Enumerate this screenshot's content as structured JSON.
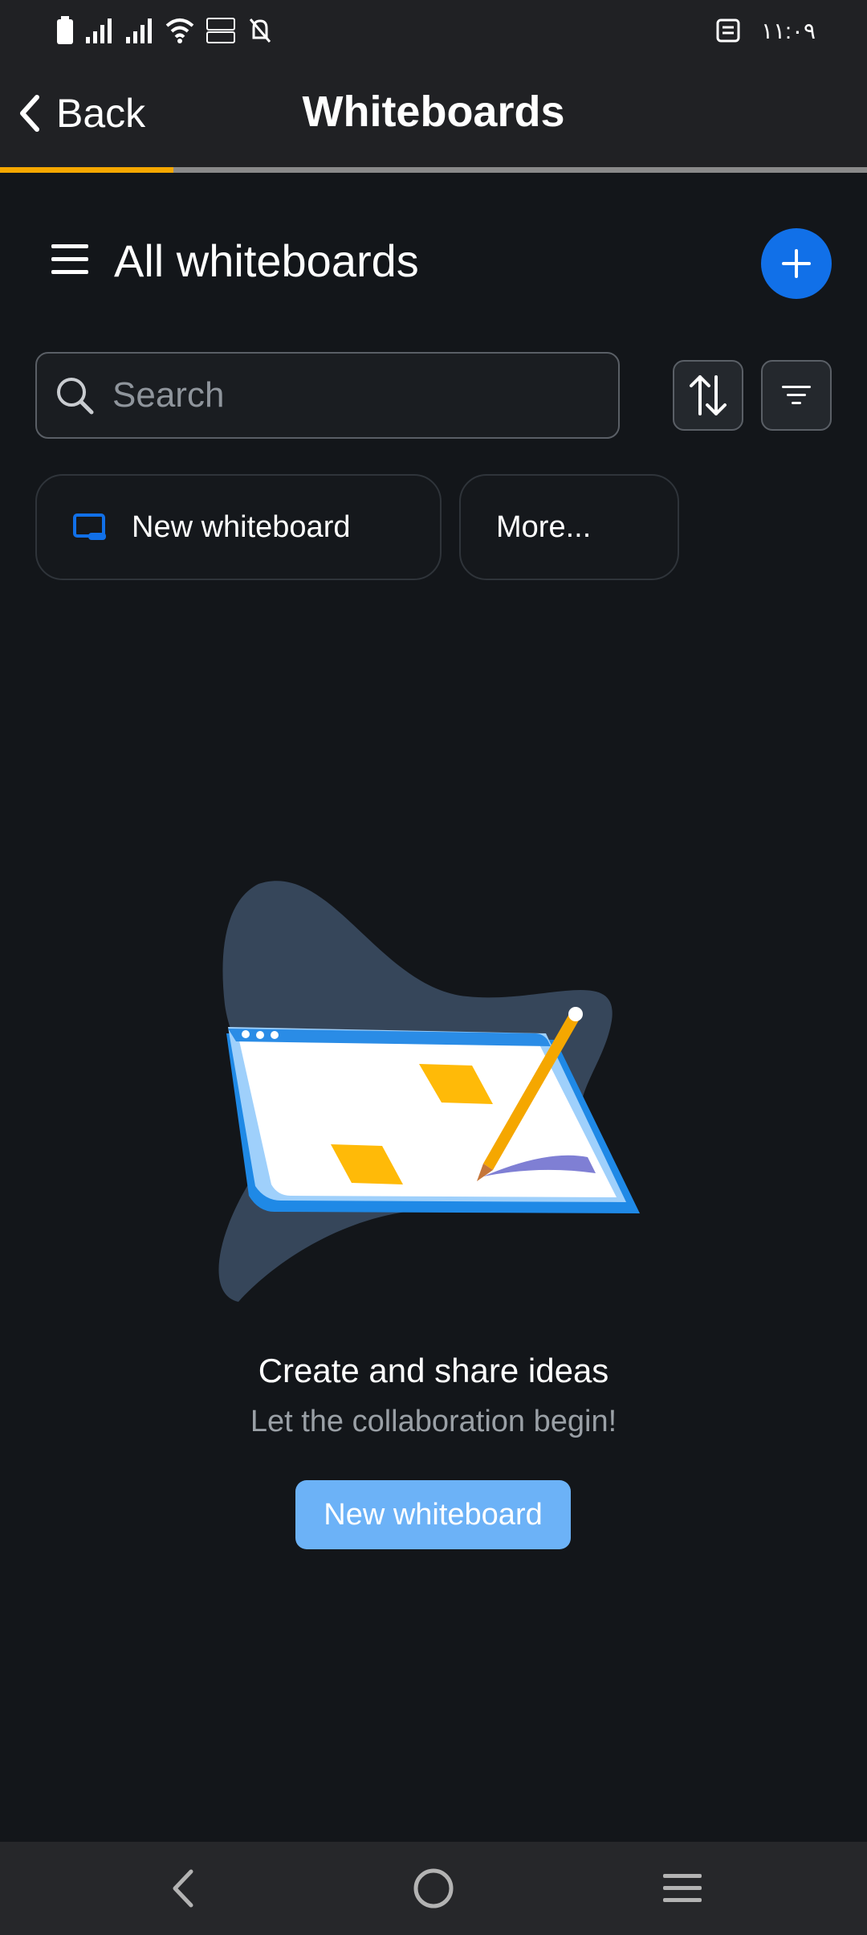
{
  "status_bar": {
    "time": "١١:٠٩",
    "icons": [
      "battery-icon",
      "signal-icon",
      "signal-icon",
      "wifi-icon",
      "volte-icon",
      "mute-icon",
      "notification-icon"
    ]
  },
  "app_bar": {
    "back_label": "Back",
    "title": "Whiteboards",
    "progress_fraction": 0.2
  },
  "header": {
    "title": "All whiteboards"
  },
  "search": {
    "placeholder": "Search",
    "value": ""
  },
  "chips": {
    "new_whiteboard": "New whiteboard",
    "more": "More..."
  },
  "empty_state": {
    "title": "Create and share ideas",
    "subtitle": "Let the collaboration begin!",
    "button_label": "New whiteboard"
  },
  "colors": {
    "accent": "#1170e8",
    "progress": "#f5a700",
    "primary_button": "#6cb2f7",
    "background": "#13161a"
  }
}
